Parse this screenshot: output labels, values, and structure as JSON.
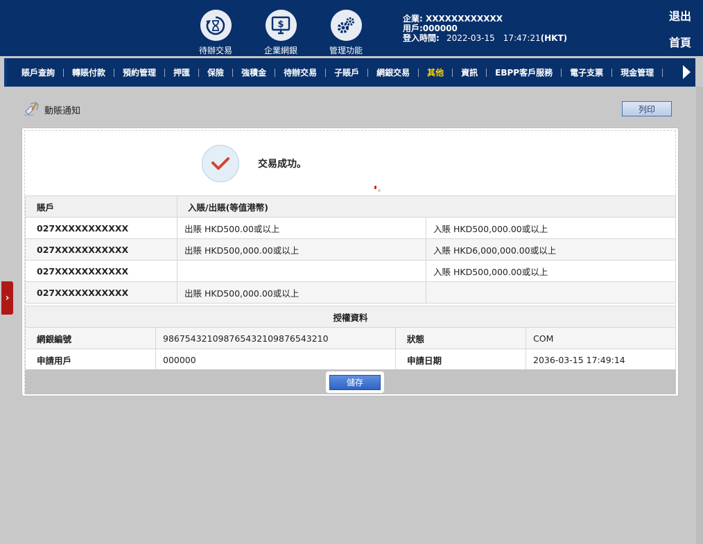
{
  "header": {
    "icons": [
      {
        "label": "待辦交易",
        "icon": "hourglass-cycle-icon"
      },
      {
        "label": "企業網銀",
        "icon": "monitor-dollar-icon"
      },
      {
        "label": "管理功能",
        "icon": "gears-icon"
      }
    ],
    "company_label": "企業: XXXXXXXXXXXX",
    "user_label": "用戶:000000",
    "login_label": "登入時間:",
    "login_time": "2022-03-15　17:47:21",
    "login_tz": "(HKT)",
    "logout": "退出",
    "home": "首頁"
  },
  "menu": [
    "賬戶查詢",
    "轉賬付款",
    "預約管理",
    "押匯",
    "保險",
    "強積金",
    "待辦交易",
    "子賬戶",
    "網銀交易",
    "其他",
    "資訊",
    "EBPP客戶服務",
    "電子支票",
    "現金管理"
  ],
  "menu_active": "其他",
  "page": {
    "title": "動賬通知",
    "print_label": "列印",
    "success_text": "交易成功。"
  },
  "notify_table": {
    "headers": [
      "賬戶",
      "入賬/出賬(等值港幣)"
    ],
    "rows": [
      {
        "account": "027XXXXXXXXXXX",
        "debit": "出賬 HKD500.00或以上",
        "credit": "入賬 HKD500,000.00或以上"
      },
      {
        "account": "027XXXXXXXXXXX",
        "debit": "出賬 HKD500,000.00或以上",
        "credit": "入賬 HKD6,000,000.00或以上"
      },
      {
        "account": "027XXXXXXXXXXX",
        "debit": "",
        "credit": "入賬 HKD500,000.00或以上"
      },
      {
        "account": "027XXXXXXXXXXX",
        "debit": "出賬 HKD500,000.00或以上",
        "credit": ""
      }
    ]
  },
  "auth": {
    "title": "授權資料",
    "ref_label": "網銀編號",
    "ref_value": "98675432109876543210987654321O",
    "status_label": "狀態",
    "status_value": "COM",
    "user_label": "申請用戶",
    "user_value": "000000",
    "date_label": "申請日期",
    "date_value": "2036-03-15 17:49:14"
  },
  "save_label": "儲存"
}
